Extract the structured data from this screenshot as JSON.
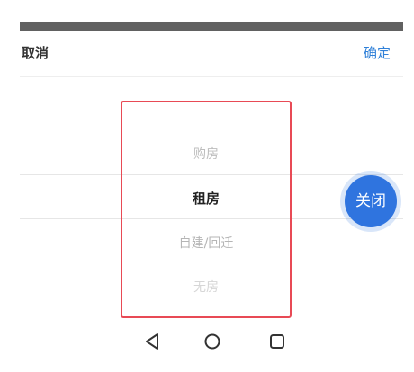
{
  "header": {
    "cancel_label": "取消",
    "confirm_label": "确定"
  },
  "picker": {
    "options": [
      "购房",
      "租房",
      "自建/回迁",
      "无房"
    ],
    "selected": "租房"
  },
  "fab": {
    "label": "关闭"
  },
  "nav": {
    "icons": [
      "back-triangle-icon",
      "home-circle-icon",
      "recent-square-icon"
    ]
  },
  "colors": {
    "accent": "#2f80d8",
    "fab": "#2f74df",
    "highlight_border": "#e84a55",
    "status_bar": "#616161"
  }
}
